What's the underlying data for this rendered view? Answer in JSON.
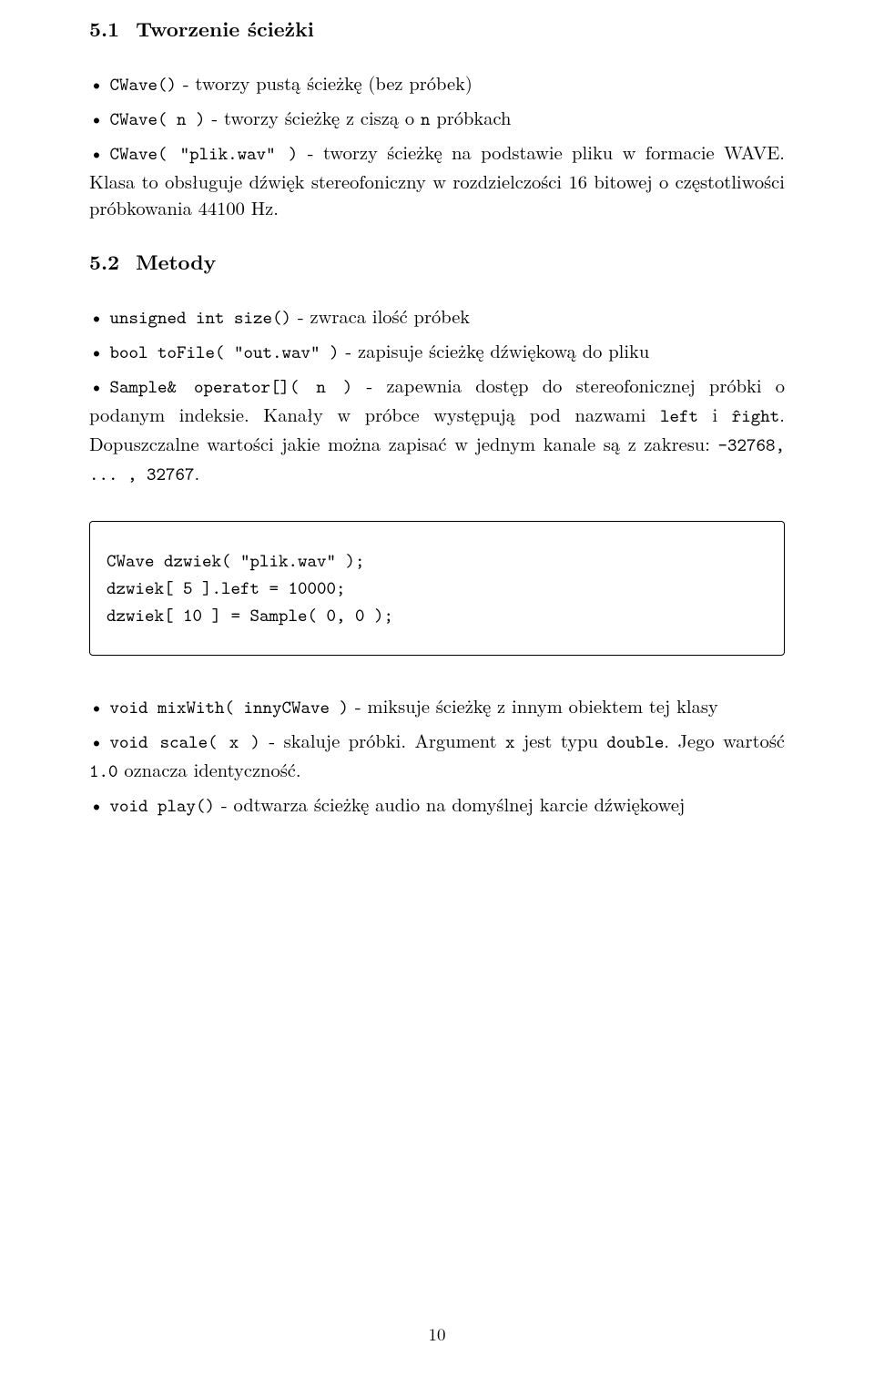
{
  "section1": {
    "number": "5.1",
    "title": "Tworzenie ścieżki"
  },
  "b1": "CWave()",
  "b1_desc": " - tworzy pustą ścieżkę (bez próbek)",
  "b2": "CWave( n )",
  "b2_desc": " - tworzy ścieżkę z ciszą o ",
  "b2_tt": "n",
  "b2_desc2": " próbkach",
  "b3": "CWave( \"plik.wav\" )",
  "b3_desc": " - tworzy ścieżkę na podstawie pliku w formacie WAVE. Klasa to obsługuje dźwięk stereofoniczny w rozdzielczości 16 bitowej o częstotliwości próbkowania 44100 Hz.",
  "section2": {
    "number": "5.2",
    "title": "Metody"
  },
  "m1": "unsigned int size()",
  "m1_desc": " - zwraca ilość próbek",
  "m2": "bool toFile( \"out.wav\" )",
  "m2_desc": " - zapisuje ścieżkę dźwiękową do pliku",
  "m3": "Sample& operator[]( n )",
  "m3_desc1": " - zapewnia dostęp do stereofonicznej próbki o podanym indeksie. Kanały w próbce występują pod nazwami ",
  "m3_tt1": "left",
  "m3_desc2": " i ",
  "m3_tt2": "r̂ight",
  "m3_desc3": ". Dopuszczalne wartości jakie można zapisać w jednym kanale są z zakresu: ",
  "m3_tt3": "-32768, ... , 32767",
  "m3_desc4": ".",
  "code": "CWave dzwiek( \"plik.wav\" );\ndzwiek[ 5 ].left = 10000;\ndzwiek[ 10 ] = Sample( 0, 0 );",
  "m4": "void mixWith( innyCWave )",
  "m4_desc": " - miksuje ścieżkę z innym obiektem tej klasy",
  "m5": "void scale( x )",
  "m5_desc1": " - skaluje próbki. Argument ",
  "m5_tt1": "x",
  "m5_desc2": " jest typu ",
  "m5_tt2": "double",
  "m5_desc3": ". Jego wartość ",
  "m5_tt3": "1.0",
  "m5_desc4": " oznacza identyczność.",
  "m6": "void play()",
  "m6_desc": " - odtwarza ścieżkę audio na domyślnej karcie dźwiękowej",
  "page_number": "10"
}
